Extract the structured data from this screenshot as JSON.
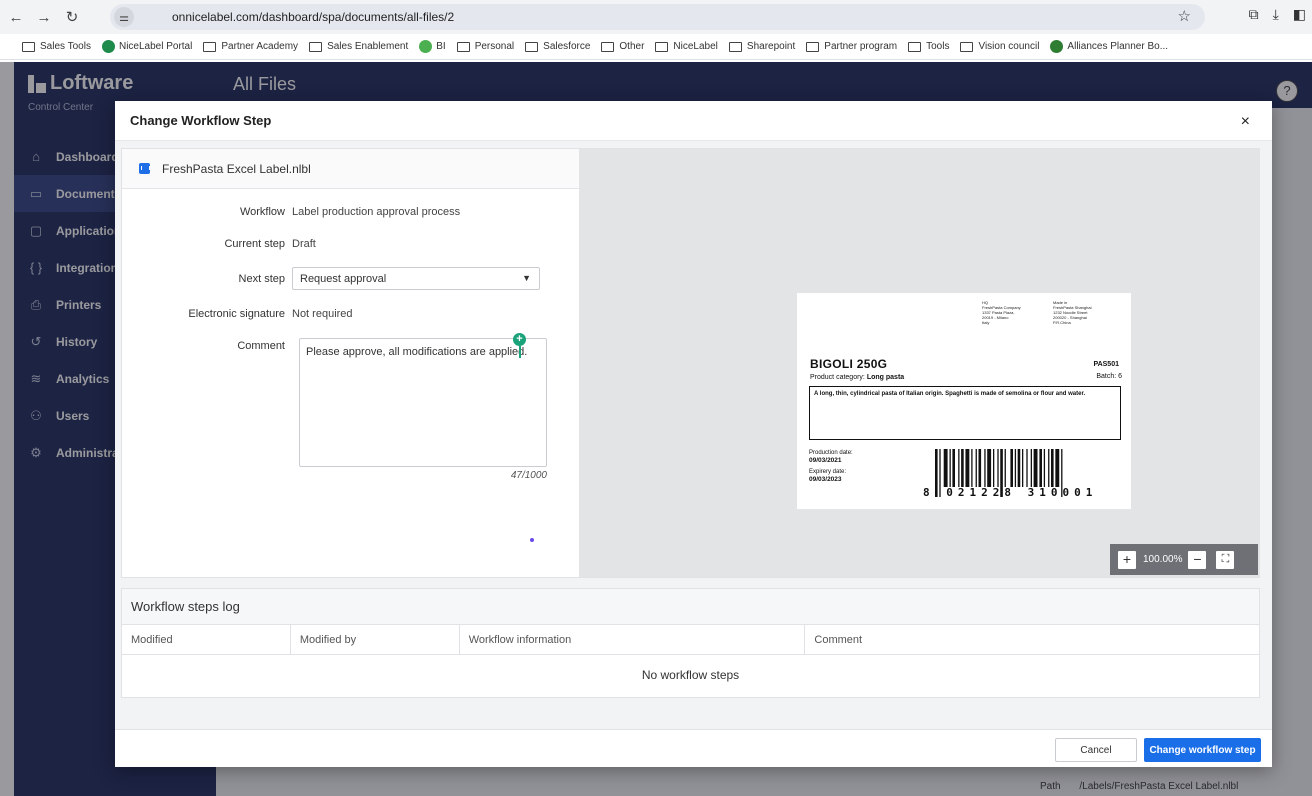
{
  "browser": {
    "url": "onnicelabel.com/dashboard/spa/documents/all-files/2",
    "bookmarks": [
      {
        "label": "Sales Tools",
        "type": "folder"
      },
      {
        "label": "NiceLabel Portal",
        "type": "fav",
        "color": "#1e8a4c"
      },
      {
        "label": "Partner Academy",
        "type": "folder"
      },
      {
        "label": "Sales Enablement",
        "type": "folder"
      },
      {
        "label": "BI",
        "type": "fav",
        "color": "#4caf50"
      },
      {
        "label": "Personal",
        "type": "folder"
      },
      {
        "label": "Salesforce",
        "type": "folder"
      },
      {
        "label": "Other",
        "type": "folder"
      },
      {
        "label": "NiceLabel",
        "type": "folder"
      },
      {
        "label": "Sharepoint",
        "type": "folder"
      },
      {
        "label": "Partner program",
        "type": "folder"
      },
      {
        "label": "Tools",
        "type": "folder"
      },
      {
        "label": "Vision council",
        "type": "folder"
      },
      {
        "label": "Alliances Planner Bo...",
        "type": "fav",
        "color": "#2e7d32"
      }
    ]
  },
  "app": {
    "brand": "Loftware",
    "subtitle": "Control Center",
    "page_title": "All Files",
    "help": "?",
    "nav": [
      {
        "label": "Dashboard",
        "icon": "home-icon",
        "glyph": "⌂",
        "active": false
      },
      {
        "label": "Documents",
        "icon": "folder-icon",
        "glyph": "▭",
        "active": true
      },
      {
        "label": "Applications",
        "icon": "window-icon",
        "glyph": "▢",
        "active": false
      },
      {
        "label": "Integrations",
        "icon": "braces-icon",
        "glyph": "{ }",
        "active": false
      },
      {
        "label": "Printers",
        "icon": "printer-icon",
        "glyph": "⎙",
        "active": false
      },
      {
        "label": "History",
        "icon": "history-icon",
        "glyph": "↺",
        "active": false
      },
      {
        "label": "Analytics",
        "icon": "analytics-icon",
        "glyph": "≋",
        "active": false
      },
      {
        "label": "Users",
        "icon": "users-icon",
        "glyph": "⚇",
        "active": false
      },
      {
        "label": "Administration",
        "icon": "gear-icon",
        "glyph": "⚙",
        "active": false
      }
    ]
  },
  "modal": {
    "title": "Change Workflow Step",
    "close": "×",
    "file_name": "FreshPasta Excel Label.nlbl",
    "fields": {
      "workflow_label": "Workflow",
      "workflow_value": "Label production approval process",
      "current_label": "Current step",
      "current_value": "Draft",
      "next_label": "Next step",
      "next_value": "Request approval",
      "sig_label": "Electronic signature",
      "sig_value": "Not required",
      "comment_label": "Comment",
      "comment_value": "Please approve, all modifications are applied.",
      "comment_counter": "47/1000"
    },
    "label_preview": {
      "hq_lines": [
        "HQ",
        "FreshPasta Company",
        "1337 Pasta Plaza,",
        "20019 - Milano",
        "Italy"
      ],
      "made_lines": [
        "Made in",
        "FreshPasta Shanghai",
        "1232 Noodle Street",
        "200020 - Shanghai",
        "P.R.China"
      ],
      "product": "BIGOLI 250G",
      "code": "PAS501",
      "category_label": "Product category:",
      "category_value": "Long pasta",
      "batch": "Batch: 6",
      "description": "A long, thin, cylindrical pasta of Italian origin. Spaghetti is made of semolina or flour and water.",
      "production_label": "Production date:",
      "production_value": "09/03/2021",
      "expiry_label": "Expirery date:",
      "expiry_value": "09/03/2023",
      "barcode_digits": "8 021228 310001"
    },
    "zoom": {
      "plus": "+",
      "value": "100.00%",
      "minus": "−",
      "fit": "⛶"
    },
    "log": {
      "title": "Workflow steps log",
      "columns": [
        "Modified",
        "Modified by",
        "Workflow information",
        "Comment"
      ],
      "empty": "No workflow steps"
    },
    "buttons": {
      "cancel": "Cancel",
      "confirm": "Change workflow step"
    }
  },
  "background": {
    "path_label": "Path",
    "path_value": "/Labels/FreshPasta Excel Label.nlbl"
  }
}
